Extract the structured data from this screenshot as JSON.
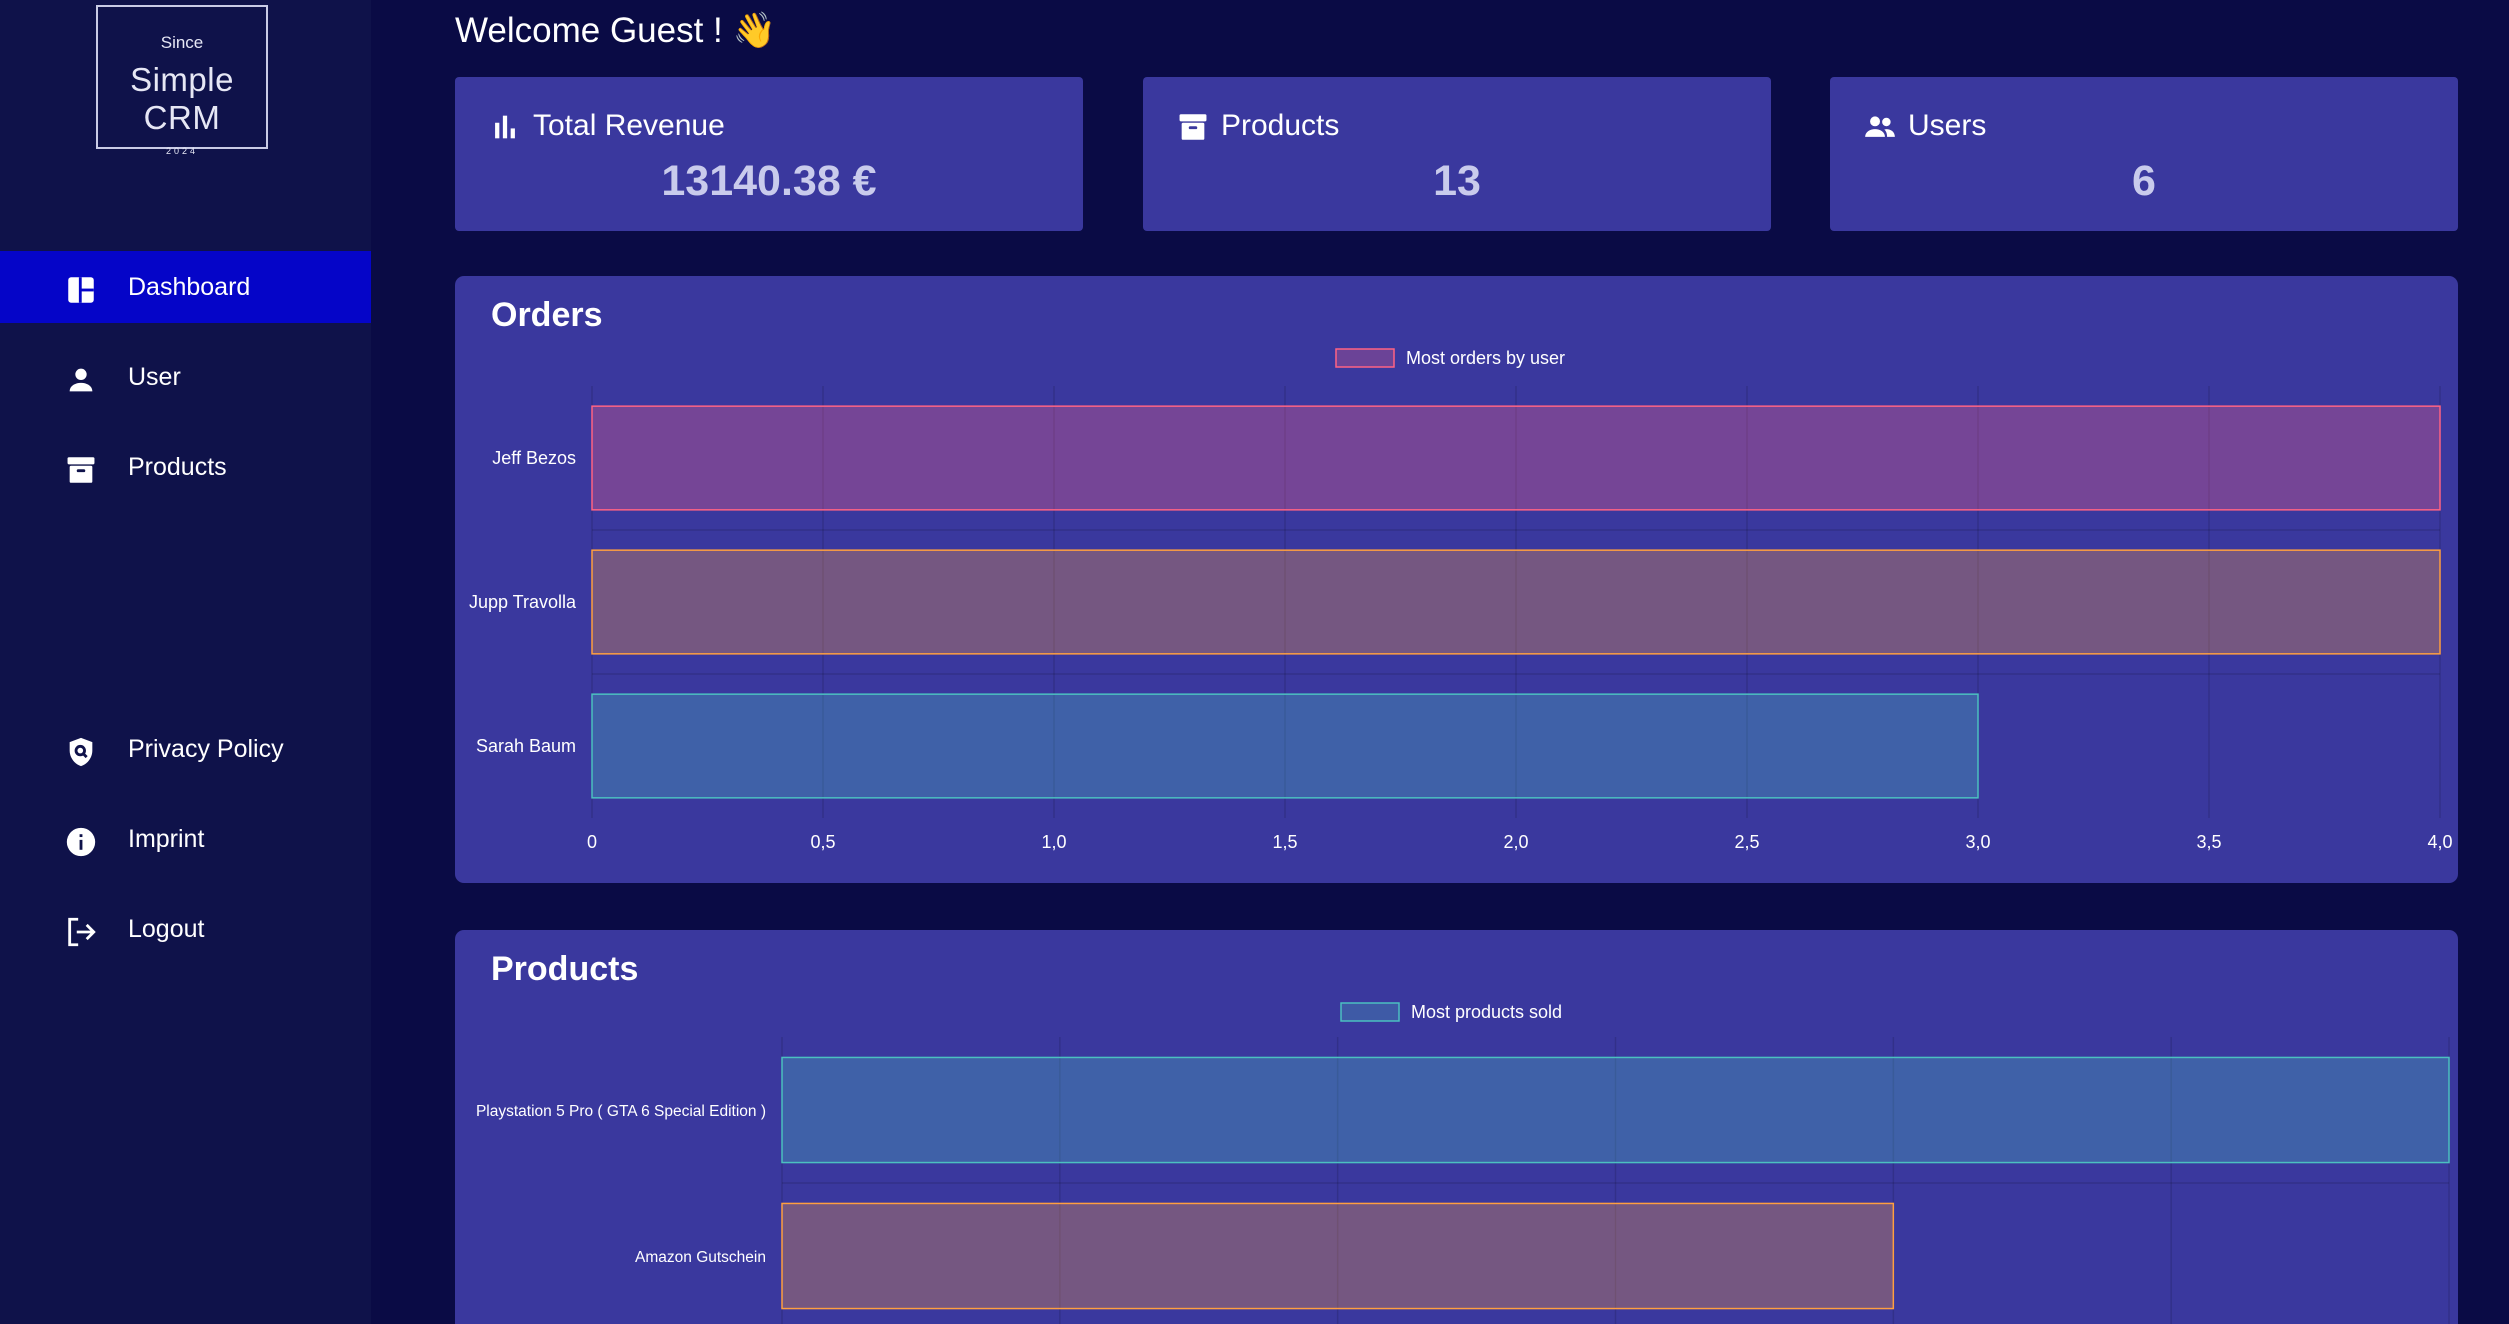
{
  "sidebar": {
    "logo": {
      "since": "Since",
      "name": "Simple CRM",
      "year": "2024"
    },
    "nav": [
      {
        "label": "Dashboard",
        "icon": "dashboard-icon",
        "active": true
      },
      {
        "label": "User",
        "icon": "person-icon"
      },
      {
        "label": "Products",
        "icon": "archive-box-icon"
      }
    ],
    "footer_nav": [
      {
        "label": "Privacy Policy",
        "icon": "shield-icon"
      },
      {
        "label": "Imprint",
        "icon": "info-icon"
      },
      {
        "label": "Logout",
        "icon": "logout-icon"
      }
    ]
  },
  "main": {
    "welcome": "Welcome Guest ! 👋",
    "cards": [
      {
        "title": "Total Revenue",
        "value": "13140.38 €",
        "icon": "bar-chart-icon"
      },
      {
        "title": "Products",
        "value": "13",
        "icon": "archive-box-icon"
      },
      {
        "title": "Users",
        "value": "6",
        "icon": "people-icon"
      }
    ],
    "orders_panel": {
      "title": "Orders"
    },
    "products_panel": {
      "title": "Products"
    }
  },
  "colors": {
    "background": "#0a0b45",
    "sidebar": "#0f124a",
    "active_nav": "#0505c8",
    "panel": "#3a389e",
    "series_pink": "#ff6384",
    "series_orange": "#ff9f40",
    "series_teal": "#4bc0c0"
  },
  "chart_data": [
    {
      "type": "bar",
      "orientation": "horizontal",
      "title": "",
      "legend_position": "top",
      "categories": [
        "Jeff Bezos",
        "Jupp Travolla",
        "Sarah Baum"
      ],
      "series": [
        {
          "name": "Most orders by user",
          "values": [
            4,
            4,
            3
          ]
        }
      ],
      "xlim": [
        0,
        4
      ],
      "x_ticks": [
        "0",
        "0,5",
        "1,0",
        "1,5",
        "2,0",
        "2,5",
        "3,0",
        "3,5",
        "4,0"
      ],
      "grid": true
    },
    {
      "type": "bar",
      "orientation": "horizontal",
      "title": "",
      "legend_position": "top",
      "categories": [
        "Playstation 5 Pro ( GTA 6 Special Edition )",
        "Amazon Gutschein"
      ],
      "series": [
        {
          "name": "Most products sold",
          "values": [
            6,
            4
          ]
        }
      ],
      "xlim": [
        0,
        6
      ],
      "grid": true
    }
  ]
}
